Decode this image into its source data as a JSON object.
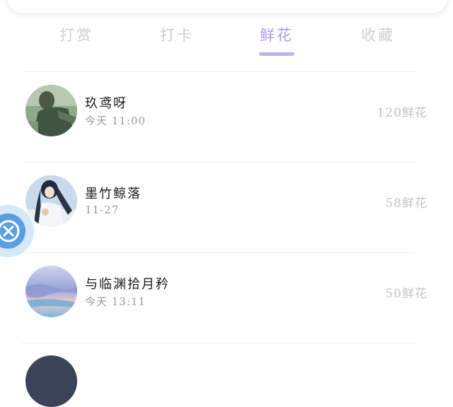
{
  "tabs": [
    {
      "label": "打赏",
      "active": false
    },
    {
      "label": "打卡",
      "active": false
    },
    {
      "label": "鲜花",
      "active": true
    },
    {
      "label": "收藏",
      "active": false
    }
  ],
  "list": [
    {
      "name": "玖鸢呀",
      "time": "今天 11:00",
      "count": "120鲜花",
      "avatar_icon": "avatar-person-green"
    },
    {
      "name": "墨竹鲸落",
      "time": "11-27",
      "count": "58鲜花",
      "avatar_icon": "avatar-girl-blue"
    },
    {
      "name": "与临渊拾月矜",
      "time": "今天 13:11",
      "count": "50鲜花",
      "avatar_icon": "avatar-sky-landscape"
    }
  ],
  "float_button": {
    "icon": "close-icon"
  },
  "colors": {
    "accent": "#b19be8",
    "tab_inactive": "#cfcfcf",
    "float_button": "#5b9fe3"
  }
}
